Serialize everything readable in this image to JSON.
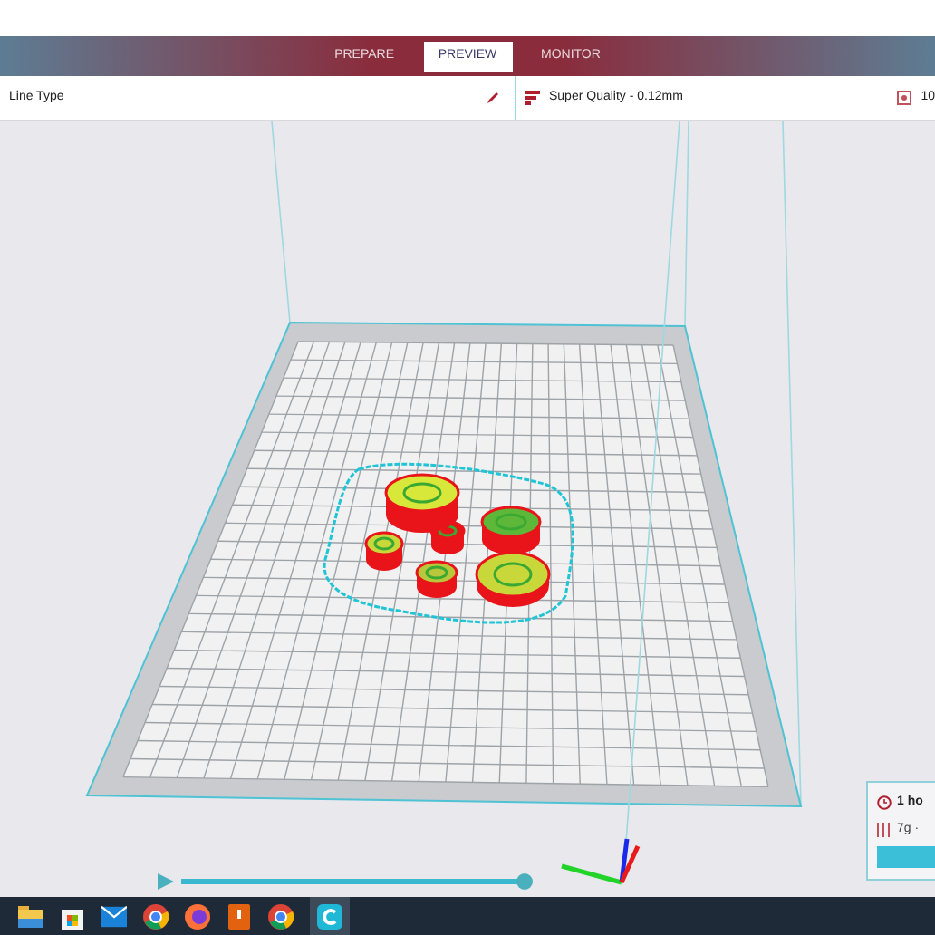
{
  "header": {
    "tabs": [
      {
        "label": "PREPARE",
        "selected": false
      },
      {
        "label": "PREVIEW",
        "selected": true
      },
      {
        "label": "MONITOR",
        "selected": false
      }
    ]
  },
  "toolbar": {
    "view_type": "Line Type",
    "profile": "Super Quality - 0.12mm",
    "support": "10"
  },
  "preview": {
    "layer_slider": {
      "level": 1
    }
  },
  "print_info": {
    "time": "1 ho",
    "material": "7g ·"
  },
  "taskbar": {
    "apps": [
      {
        "kind": "folder",
        "selected": false
      },
      {
        "kind": "store",
        "selected": false
      },
      {
        "kind": "mail",
        "selected": false
      },
      {
        "kind": "browser",
        "selected": false
      },
      {
        "kind": "fox",
        "selected": false
      },
      {
        "kind": "book",
        "selected": false
      },
      {
        "kind": "browser",
        "selected": false
      },
      {
        "kind": "slicer",
        "selected": true
      }
    ]
  }
}
